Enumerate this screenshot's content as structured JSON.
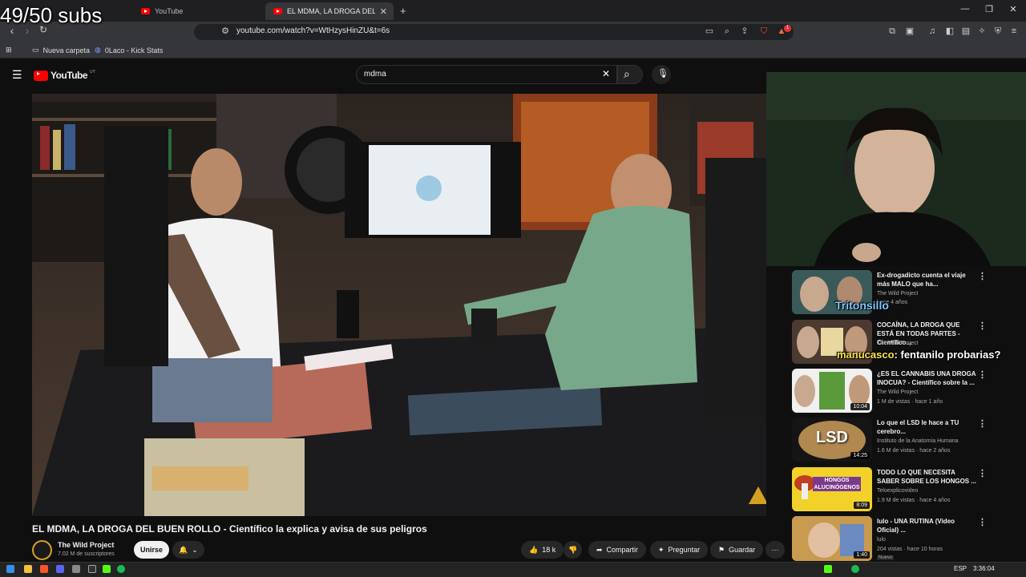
{
  "overlay": {
    "subs_goal": "49/50 subs"
  },
  "browser": {
    "tabs": [
      {
        "label": "YouTube"
      },
      {
        "label": "EL MDMA, LA DROGA DEL BUEN ROLLO"
      }
    ],
    "tab_close": "✕",
    "new_tab": "+",
    "url": "youtube.com/watch?v=WtHzysHinZU&t=6s",
    "bookmarks": [
      {
        "label": "Nueva carpeta"
      },
      {
        "label": "0Laco - Kick Stats"
      }
    ],
    "shield_badge": "1"
  },
  "youtube": {
    "logo_text": "YouTube",
    "region": "UY",
    "search_value": "mdma",
    "video": {
      "title": "EL MDMA, LA DROGA DEL BUEN ROLLO - Científico la explica y avisa de sus peligros",
      "channel": "The Wild Project",
      "subscribers": "7.02 M de suscriptores",
      "join_label": "Unirse",
      "likes": "18 k",
      "share_label": "Compartir",
      "ask_label": "Preguntar",
      "save_label": "Guardar"
    },
    "recommendations": [
      {
        "title": "Ex-drogadicto cuenta el viaje más MALO que ha...",
        "channel": "The Wild Project",
        "meta": "hace 4 años",
        "duration": ""
      },
      {
        "title": "COCAÍNA, LA DROGA QUE ESTÁ EN TODAS PARTES - Científico...",
        "channel": "The Wild Project",
        "meta": "",
        "duration": ""
      },
      {
        "title": "¿ES EL CANNABIS UNA DROGA INOCUA? - Científico sobre la ...",
        "channel": "The Wild Project",
        "meta": "1 M de vistas · hace 1 año",
        "duration": "10:04"
      },
      {
        "title": "Lo que el LSD le hace a TU cerebro...",
        "channel": "Instituto de la Anatomía Humana",
        "meta": "1.6 M de vistas · hace 2 años",
        "duration": "14:25",
        "thumb_text": "LSD"
      },
      {
        "title": "TODO LO QUE NECESITA SABER SOBRE LOS HONGOS ...",
        "channel": "Teloexplicovideo",
        "meta": "1.9 M de vistas · hace 4 años",
        "duration": "8:09",
        "thumb_text": "HONGOS ALUCINÓGENOS"
      },
      {
        "title": "lulo - UNA RUTINA (Video Oficial) ...",
        "channel": "lulo",
        "meta": "204 vistas · hace 10 horas",
        "duration": "1:40",
        "badge": "Nuevo"
      }
    ]
  },
  "chat": [
    {
      "user": "Tritonsillo",
      "message": ""
    },
    {
      "user": "manucasco",
      "message": ": fentanilo probarias?"
    }
  ],
  "taskbar": {
    "lang": "ESP",
    "time": "3:36:04"
  },
  "colors": {
    "yt_red": "#ff0000",
    "bg": "#0f0f0f",
    "chat_green": "#3fbf3f"
  }
}
